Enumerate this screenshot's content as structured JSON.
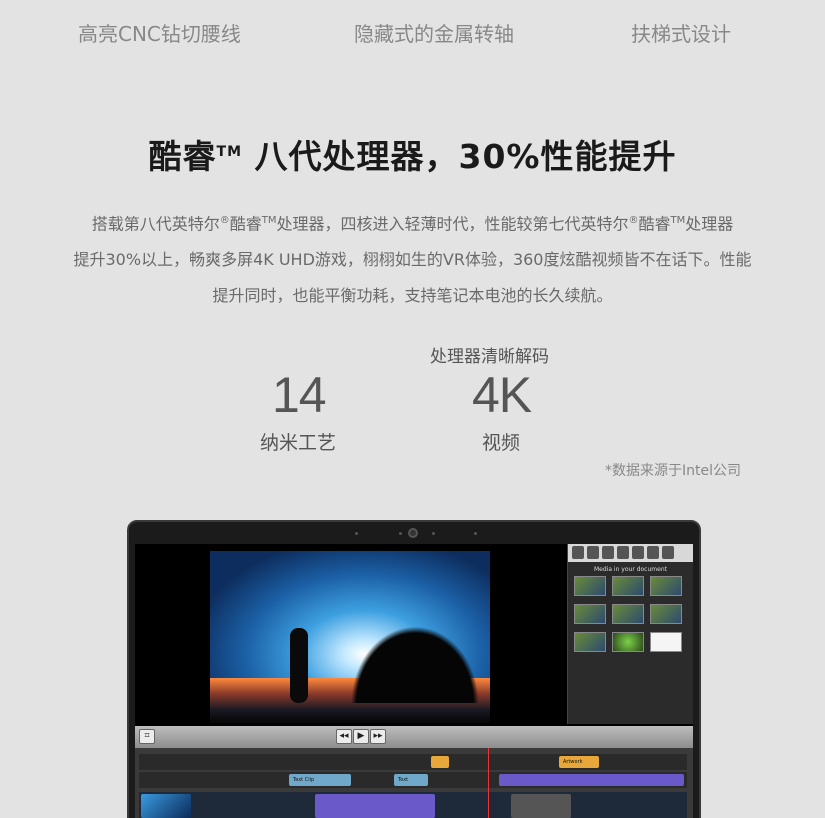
{
  "features": {
    "item1": "高亮CNC钻切腰线",
    "item2": "隐藏式的金属转轴",
    "item3": "扶梯式设计"
  },
  "headline": {
    "pre": "酷睿",
    "tm": "TM",
    "post": " 八代处理器，30%性能提升"
  },
  "description": {
    "line1_a": "搭载第八代英特尔",
    "reg1": "®",
    "line1_b": "酷睿",
    "tm1": "TM",
    "line1_c": "处理器，四核进入轻薄时代，性能较第七代英特尔",
    "reg2": "®",
    "line1_d": "酷睿",
    "tm2": "TM",
    "line1_e": "处理器",
    "line2": "提升30%以上，畅爽多屏4K UHD游戏，栩栩如生的VR体验，360度炫酷视频皆不在话下。性能",
    "line3": "提升同时，也能平衡功耗，支持笔记本电池的长久续航。"
  },
  "stats": {
    "top_label": "处理器清晰解码",
    "stat1_value": "14",
    "stat1_caption": "纳米工艺",
    "stat2_value": "4K",
    "stat2_caption": "视频",
    "source": "*数据来源于Intel公司"
  },
  "laptop_screen": {
    "panel_title": "Media in your document",
    "clips": [
      "Text Clip",
      "Text",
      "Artwork"
    ]
  },
  "colors": {
    "background": "#e3e3e3",
    "headline": "#1a1a1a",
    "body_text": "#6a6a6a"
  }
}
